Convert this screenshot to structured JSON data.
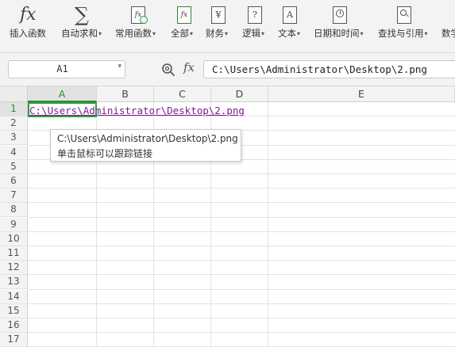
{
  "ribbon": {
    "buttons": [
      {
        "label": "插入函数",
        "caret": false,
        "icon": "fx-icon"
      },
      {
        "label": "自动求和",
        "caret": true,
        "icon": "sigma-icon"
      },
      {
        "label": "常用函数",
        "caret": true,
        "icon": "common-function-icon"
      },
      {
        "label": "全部",
        "caret": true,
        "icon": "all-functions-icon"
      },
      {
        "label": "财务",
        "caret": true,
        "icon": "finance-icon"
      },
      {
        "label": "逻辑",
        "caret": true,
        "icon": "logic-icon"
      },
      {
        "label": "文本",
        "caret": true,
        "icon": "text-function-icon"
      },
      {
        "label": "日期和时间",
        "caret": true,
        "icon": "datetime-icon"
      },
      {
        "label": "查找与引用",
        "caret": true,
        "icon": "lookup-icon"
      },
      {
        "label": "数学",
        "caret": false,
        "icon": "math-icon"
      }
    ],
    "caret_glyph": "▾",
    "icon_glyphs": {
      "fx": "fx",
      "sigma": "∑",
      "finance": "¥",
      "logic": "?",
      "text": "A"
    }
  },
  "formula_bar": {
    "name_box": "A1",
    "fx_label": "fx",
    "content": "C:\\Users\\Administrator\\Desktop\\2.png"
  },
  "sheet": {
    "columns": [
      "A",
      "B",
      "C",
      "D",
      "E"
    ],
    "rows": [
      "1",
      "2",
      "3",
      "4",
      "5",
      "6",
      "7",
      "8",
      "9",
      "10",
      "11",
      "12",
      "13",
      "14",
      "15",
      "16",
      "17"
    ],
    "selected_cell": "A1",
    "cell_a1": "C:\\Users\\Administrator\\Desktop\\2.png"
  },
  "tooltip": {
    "path": "C:\\Users\\Administrator\\Desktop\\2.png",
    "hint": "单击鼠标可以跟踪链接"
  },
  "colors": {
    "selection": "#2e9e3c",
    "hyperlink": "#7a1e8c",
    "ribbon_bg": "#f3f3f3"
  }
}
